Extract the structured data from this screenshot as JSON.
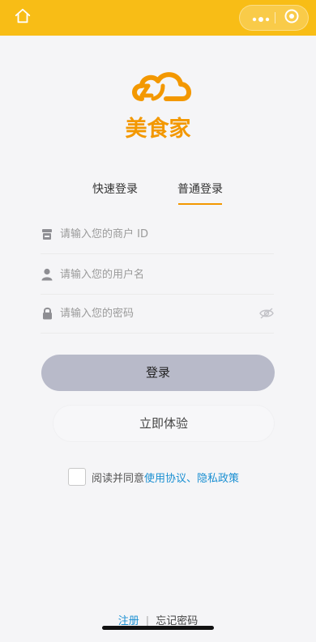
{
  "brand": {
    "name": "美食家",
    "accent_color": "#f39800",
    "topbar_color": "#f8bd16"
  },
  "topbar": {
    "home_icon": "home-icon",
    "more_icon": "more-dots-icon",
    "close_icon": "target-close-icon"
  },
  "tabs": [
    {
      "label": "快速登录",
      "active": false
    },
    {
      "label": "普通登录",
      "active": true
    }
  ],
  "form": {
    "merchant_placeholder": "请输入您的商户 ID",
    "username_placeholder": "请输入您的用户名",
    "password_placeholder": "请输入您的密码"
  },
  "buttons": {
    "login_label": "登录",
    "try_label": "立即体验"
  },
  "agreement": {
    "prefix": "阅读并同意",
    "terms_link": "使用协议",
    "separator": "、",
    "privacy_link": "隐私政策"
  },
  "footer": {
    "register_label": "注册",
    "divider": "|",
    "forgot_label": "忘记密码"
  }
}
